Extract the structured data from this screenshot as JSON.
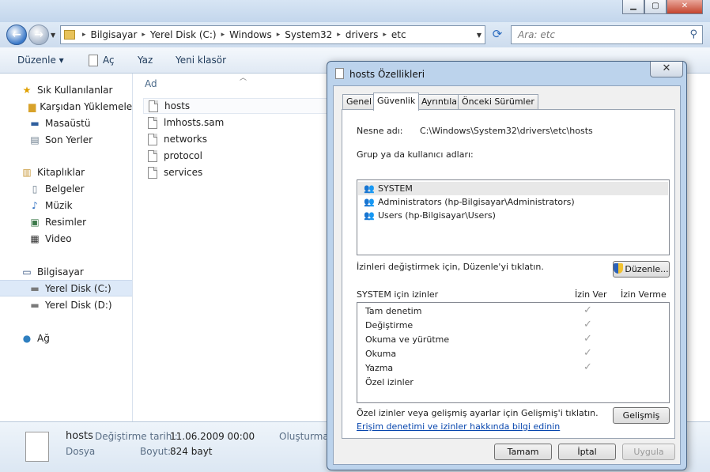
{
  "explorer": {
    "window_buttons": [
      "▁",
      "▢",
      "✕"
    ],
    "address": {
      "crumbs": [
        "Bilgisayar",
        "Yerel Disk (C:)",
        "Windows",
        "System32",
        "drivers",
        "etc"
      ]
    },
    "search": {
      "placeholder": "Ara: etc"
    },
    "commands": {
      "organize": "Düzenle ▾",
      "open": "Aç",
      "print": "Yaz",
      "new_folder": "Yeni klasör"
    },
    "nav": {
      "favorites": "Sık Kullanılanlar",
      "downloads": "Karşıdan Yüklemeler",
      "desktop": "Masaüstü",
      "recent": "Son Yerler",
      "libraries": "Kitaplıklar",
      "documents": "Belgeler",
      "music": "Müzik",
      "pictures": "Resimler",
      "video": "Video",
      "computer": "Bilgisayar",
      "drive_c": "Yerel Disk (C:)",
      "drive_d": "Yerel Disk (D:)",
      "network": "Ağ"
    },
    "file_column": "Ad",
    "files": [
      "hosts",
      "lmhosts.sam",
      "networks",
      "protocol",
      "services"
    ],
    "details": {
      "name": "hosts",
      "type": "Dosya",
      "modified_label": "Değiştirme tarihi:",
      "modified_value": "11.06.2009 00:00",
      "size_label": "Boyut:",
      "size_value": "824 bayt",
      "created_label": "Oluşturma"
    }
  },
  "dialog": {
    "title": "hosts Özellikleri",
    "close": "✕",
    "tabs": [
      "Genel",
      "Güvenlik",
      "Ayrıntılar",
      "Önceki Sürümler"
    ],
    "object_label": "Nesne adı:",
    "object_value": "C:\\Windows\\System32\\drivers\\etc\\hosts",
    "group_label": "Grup ya da kullanıcı adları:",
    "users": [
      "SYSTEM",
      "Administrators (hp-Bilgisayar\\Administrators)",
      "Users (hp-Bilgisayar\\Users)"
    ],
    "change_hint": "İzinleri değiştirmek için, Düzenle'yi tıklatın.",
    "edit_button": "Düzenle...",
    "perm_header": "SYSTEM için izinler",
    "allow_header": "İzin Ver",
    "deny_header": "İzin Verme",
    "permissions": [
      {
        "name": "Tam denetim",
        "allow": true
      },
      {
        "name": "Değiştirme",
        "allow": true
      },
      {
        "name": "Okuma ve yürütme",
        "allow": true
      },
      {
        "name": "Okuma",
        "allow": true
      },
      {
        "name": "Yazma",
        "allow": true
      },
      {
        "name": "Özel izinler",
        "allow": false
      }
    ],
    "advanced_hint": "Özel izinler veya gelişmiş ayarlar için Gelişmiş'i tıklatın.",
    "advanced_button": "Gelişmiş",
    "help_link": "Erişim denetimi ve izinler hakkında bilgi edinin",
    "ok": "Tamam",
    "cancel": "İptal",
    "apply": "Uygula",
    "check_glyph": "✓"
  }
}
